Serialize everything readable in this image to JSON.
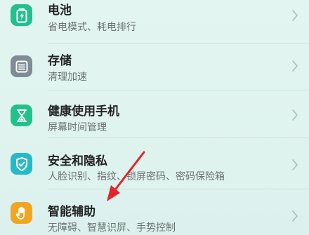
{
  "settings": {
    "items": [
      {
        "title": "电池",
        "subtitle": "省电模式、耗电排行",
        "icon": "battery-icon",
        "color": "#22c08a"
      },
      {
        "title": "存储",
        "subtitle": "清理加速",
        "icon": "storage-icon",
        "color": "#7f8b95"
      },
      {
        "title": "健康使用手机",
        "subtitle": "屏幕时间管理",
        "icon": "hourglass-icon",
        "color": "#22c08a"
      },
      {
        "title": "安全和隐私",
        "subtitle": "人脸识别、指纹、锁屏密码、密码保险箱",
        "icon": "shield-icon",
        "color": "#28b9c8"
      },
      {
        "title": "智能辅助",
        "subtitle": "无障碍、智慧识屏、手势控制",
        "icon": "hand-icon",
        "color": "#f0a623"
      }
    ]
  },
  "annotation": {
    "arrow_color": "#e0262a"
  }
}
